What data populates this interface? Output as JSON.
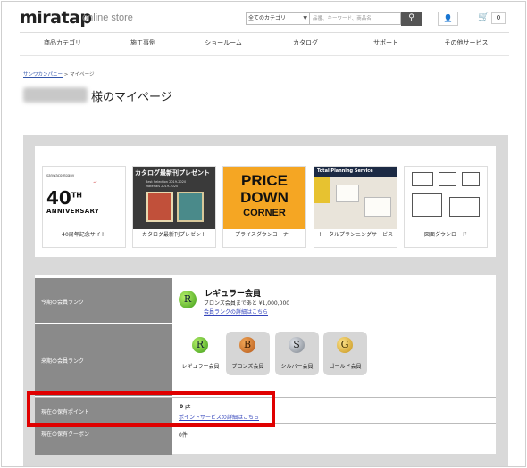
{
  "header": {
    "logo": "miratap",
    "logo_sub": "online store",
    "category_select": "全てのカテゴリ",
    "search_placeholder": "品番、キーワード、商品名",
    "cart_count": "0"
  },
  "nav": [
    "商品カテゴリ",
    "施工事例",
    "ショールーム",
    "カタログ",
    "サポート",
    "その他サービス"
  ],
  "breadcrumb": {
    "home": "サンワカンパニー",
    "sep": " > ",
    "current": "マイページ"
  },
  "page_title": "様のマイページ",
  "cards": [
    {
      "caption": "40周年記念サイト",
      "small": "sanwacompany",
      "big": "40",
      "big_sup": "TH",
      "line2": "ANNIVERSARY"
    },
    {
      "caption": "カタログ最新刊プレゼント",
      "title": "カタログ最新刊プレゼント",
      "sub1": "Best Selection 2019-2020",
      "sub2": "Materials 2019-2020"
    },
    {
      "caption": "プライスダウンコーナー",
      "l1": "PRICE",
      "l2": "DOWN",
      "l3": "CORNER"
    },
    {
      "caption": "トータルプランニングサービス",
      "banner": "Total Planning Service"
    },
    {
      "caption": "図面ダウンロード"
    }
  ],
  "info": {
    "current_rank_label": "今期の会員ランク",
    "current_rank_name": "レギュラー会員",
    "current_rank_note": "ブロンズ会員まであと ¥1,000,000",
    "current_rank_link": "会員ランクの詳細はこちら",
    "next_rank_label": "来期の会員ランク",
    "ranks": [
      {
        "letter": "R",
        "name": "レギュラー会員",
        "color": "#3b9b16"
      },
      {
        "letter": "B",
        "name": "ブロンズ会員",
        "color": "#b4591c"
      },
      {
        "letter": "S",
        "name": "シルバー会員",
        "color": "#7c838c"
      },
      {
        "letter": "G",
        "name": "ゴールド会員",
        "color": "#c6931a"
      }
    ],
    "points_label": "現在の保有ポイント",
    "points_value": "0",
    "points_unit": " pt",
    "points_link": "ポイントサービスの詳細はこちら",
    "coupon_label": "現在の保有クーポン",
    "coupon_value": "0件"
  }
}
